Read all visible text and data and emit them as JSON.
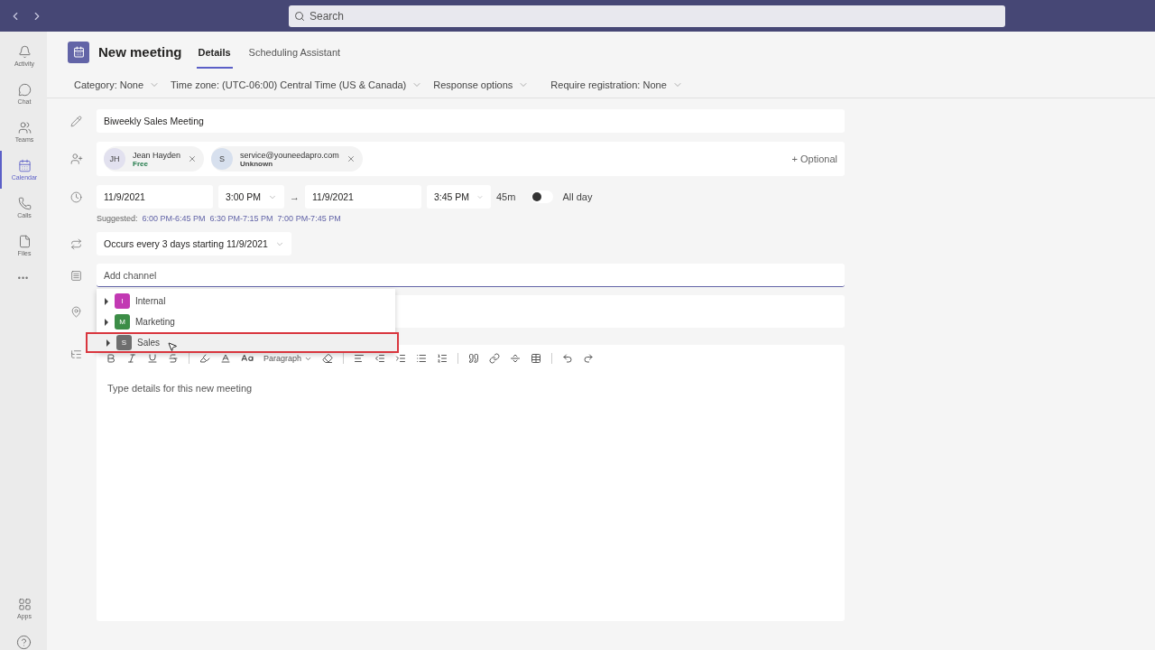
{
  "search": {
    "placeholder": "Search"
  },
  "sidebar": {
    "items": [
      {
        "label": "Activity",
        "selected": false
      },
      {
        "label": "Chat",
        "selected": false
      },
      {
        "label": "Teams",
        "selected": false
      },
      {
        "label": "Calendar",
        "selected": true
      },
      {
        "label": "Calls",
        "selected": false
      },
      {
        "label": "Files",
        "selected": false
      }
    ],
    "more": "•••",
    "bottom_items": [
      {
        "label": "Apps",
        "selected": false
      }
    ]
  },
  "header": {
    "title": "New meeting",
    "tabs": [
      {
        "label": "Details",
        "selected": true
      },
      {
        "label": "Scheduling Assistant",
        "selected": false
      }
    ]
  },
  "options": [
    "Category: None",
    "Time zone: (UTC-06:00) Central Time (US & Canada)",
    "Response options",
    "Require registration: None"
  ],
  "title_field": {
    "value": "Biweekly Sales Meeting"
  },
  "attendees": [
    {
      "initials": "JH",
      "name": "Jean Hayden",
      "status": "Free",
      "color": "#237b4b"
    },
    {
      "initials": "S",
      "name": "service@youneedapro.com",
      "status": "Unknown",
      "color": "#444444"
    }
  ],
  "optional": "+ Optional",
  "time": {
    "start_date": "11/9/2021",
    "start_time": "3:00 PM",
    "arrow": "→",
    "end_date": "11/9/2021",
    "end_time": "3:45 PM",
    "duration": "45m",
    "all_day": {
      "label": "All day",
      "on": false
    }
  },
  "suggested": {
    "label": "Suggested:",
    "slots": [
      "6:00 PM-6:45 PM",
      "6:30 PM-7:15 PM",
      "7:00 PM-7:45 PM"
    ]
  },
  "recurrence": "Occurs every 3 days starting 11/9/2021",
  "channel": {
    "placeholder": "Add channel",
    "options": [
      {
        "name": "Internal",
        "initial": "I",
        "color": "#c239b3",
        "highlighted": false
      },
      {
        "name": "Marketing",
        "initial": "M",
        "color": "#3c8d47",
        "highlighted": false
      },
      {
        "name": "Sales",
        "initial": "S",
        "color": "#6e6e6e",
        "highlighted": true
      }
    ]
  },
  "editor": {
    "paragraph": "Paragraph",
    "placeholder": "Type details for this new meeting"
  }
}
